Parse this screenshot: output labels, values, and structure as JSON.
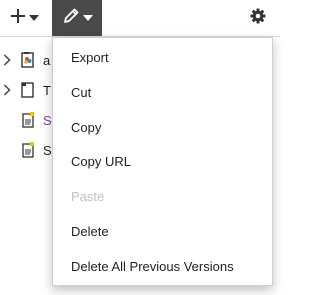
{
  "toolbar": {
    "add_icon": "plus-icon",
    "edit_icon": "pencil-icon",
    "settings_icon": "gear-icon",
    "active_color": "#4a4a4a"
  },
  "tree": {
    "items": [
      {
        "label": "a",
        "icon": "folder-icon",
        "expandable": true,
        "color": "#222222"
      },
      {
        "label": "T",
        "icon": "folder-icon",
        "expandable": true,
        "color": "#222222"
      },
      {
        "label": "S",
        "icon": "document-icon",
        "expandable": false,
        "color": "#7b3fb5"
      },
      {
        "label": "S",
        "icon": "document-icon",
        "expandable": false,
        "color": "#222222"
      }
    ]
  },
  "menu": {
    "items": [
      {
        "label": "Export",
        "disabled": false
      },
      {
        "label": "Cut",
        "disabled": false
      },
      {
        "label": "Copy",
        "disabled": false
      },
      {
        "label": "Copy URL",
        "disabled": false
      },
      {
        "label": "Paste",
        "disabled": true
      },
      {
        "label": "Delete",
        "disabled": false
      },
      {
        "label": "Delete All Previous Versions",
        "disabled": false
      }
    ]
  }
}
